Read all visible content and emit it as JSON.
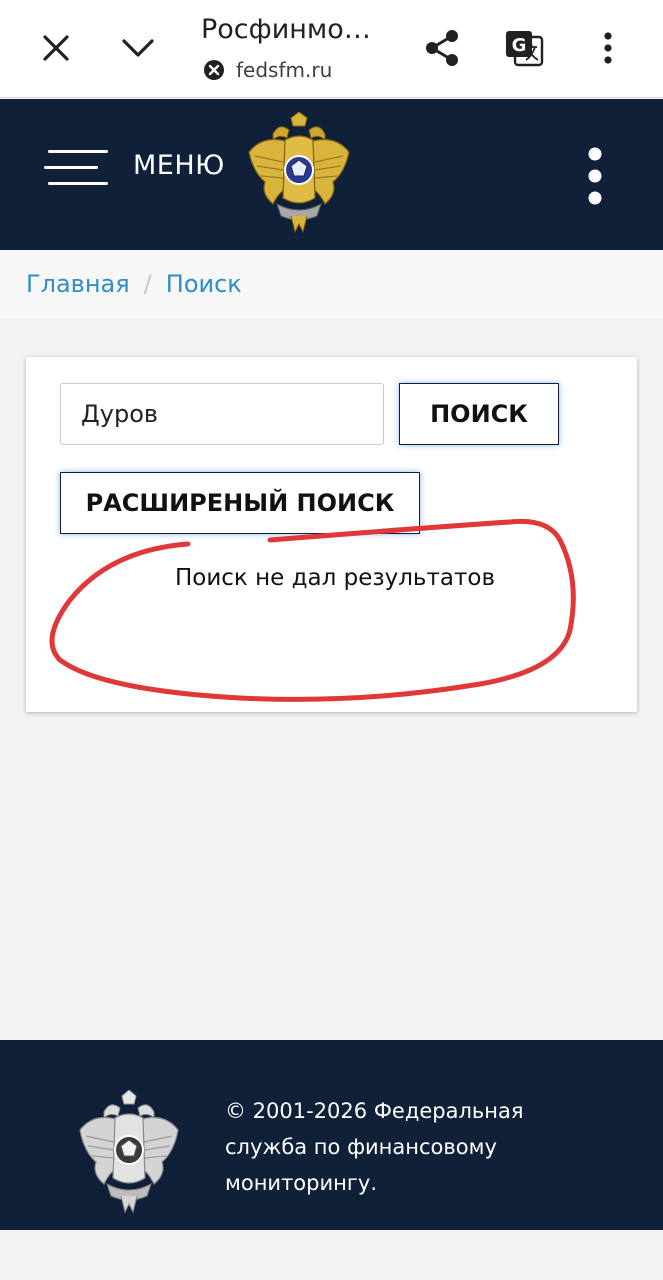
{
  "browser": {
    "title": "Росфинмо…",
    "url": "fedsfm.ru",
    "icons": [
      "close-icon",
      "chevron-down-icon",
      "share-icon",
      "translate-icon",
      "more-vertical-icon"
    ]
  },
  "header": {
    "menu_label": "МЕНЮ",
    "colors": {
      "background": "#0f2038",
      "text": "#ffffff"
    }
  },
  "breadcrumb": {
    "items": [
      "Главная",
      "Поиск"
    ],
    "separator": "/",
    "color": "#2f8ec9"
  },
  "search": {
    "query": "Дуров",
    "search_button": "ПОИСК",
    "advanced_button": "РАСШИРЕНЫЙ ПОИСК",
    "result_message": "Поиск не дал результатов"
  },
  "footer": {
    "copyright": "© 2001-2026 Федеральная служба по финансовому мониторингу."
  }
}
